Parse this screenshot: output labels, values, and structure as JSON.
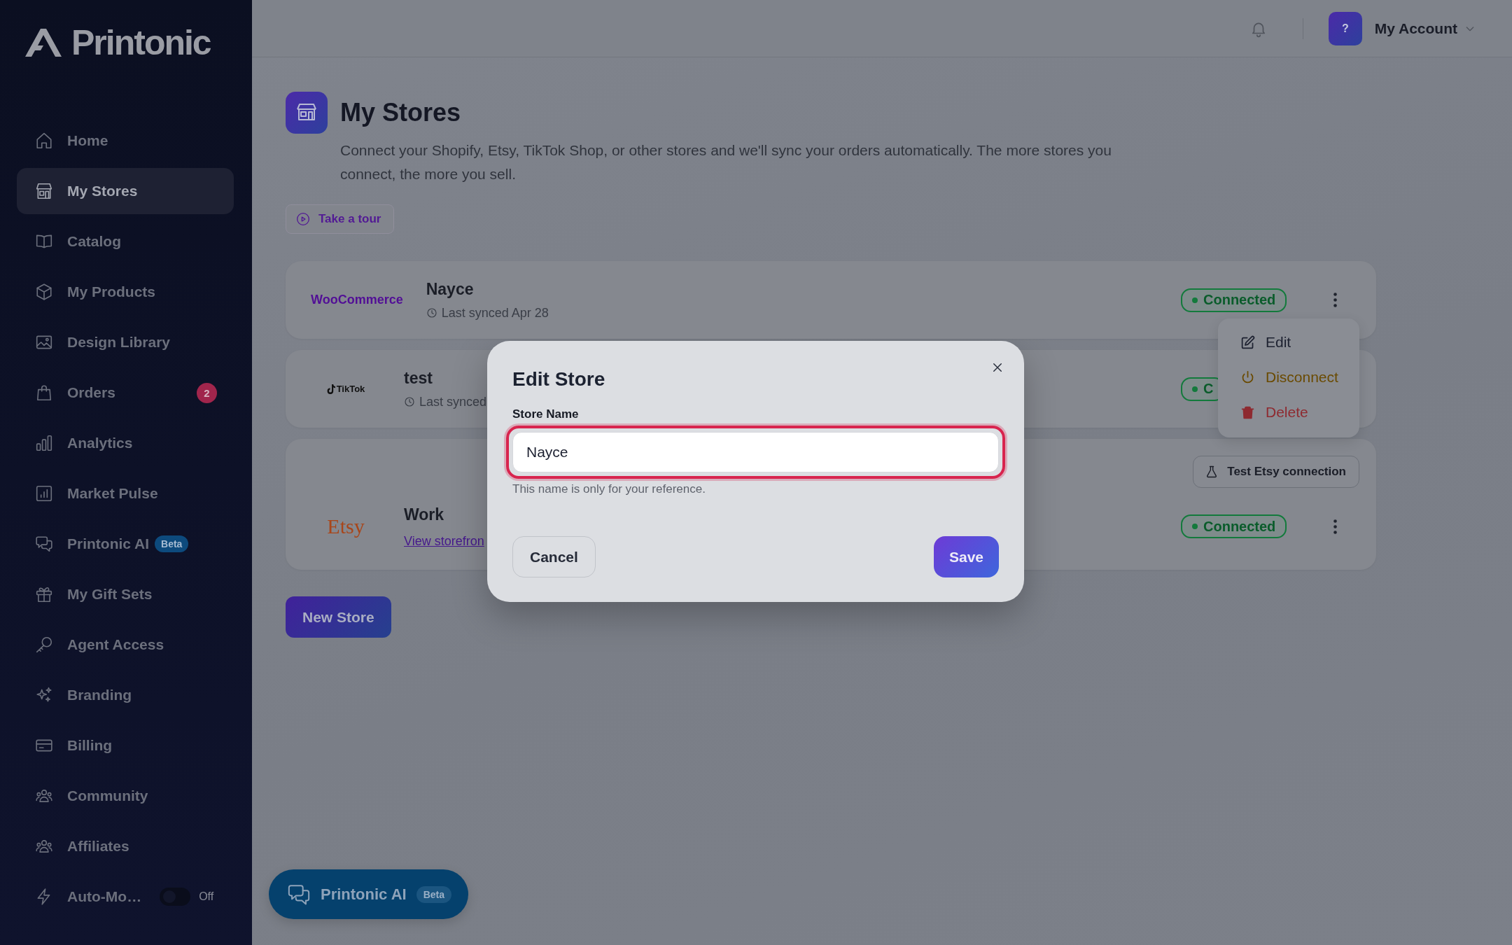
{
  "sidebar": {
    "logo": "Printonic",
    "items": [
      {
        "label": "Home",
        "selected": false
      },
      {
        "label": "My Stores",
        "selected": true
      },
      {
        "label": "Catalog",
        "selected": false
      },
      {
        "label": "My Products",
        "selected": false
      },
      {
        "label": "Design Library",
        "selected": false
      },
      {
        "label": "Orders",
        "selected": false,
        "badge": "2"
      },
      {
        "label": "Analytics",
        "selected": false
      },
      {
        "label": "Market Pulse",
        "selected": false
      },
      {
        "label": "Printonic AI",
        "selected": false,
        "tag": "Beta"
      },
      {
        "label": "My Gift Sets",
        "selected": false
      },
      {
        "label": "Agent Access",
        "selected": false
      },
      {
        "label": "Branding",
        "selected": false
      },
      {
        "label": "Billing",
        "selected": false
      },
      {
        "label": "Community",
        "selected": false
      },
      {
        "label": "Affiliates",
        "selected": false
      },
      {
        "label": "Auto-Mo…",
        "selected": false,
        "toggle": {
          "on": false,
          "label": "Off"
        }
      }
    ]
  },
  "header": {
    "account": {
      "avatar": "?",
      "name": "My Account"
    }
  },
  "page": {
    "title": "My Stores",
    "description": "Connect your Shopify, Etsy, TikTok Shop, or other stores and we'll sync your orders automatically. The more stores you connect, the more you sell.",
    "tour_button": "Take a tour",
    "new_store_button": "New Store"
  },
  "stores": [
    {
      "kind": "woocommerce",
      "platform": "WooCommerce",
      "name": "Nayce",
      "sync": "Last synced Apr 28",
      "status": "Connected",
      "menu_open": true
    },
    {
      "kind": "tiktok",
      "platform": "TikTok",
      "name": "test",
      "sync": "Last synced",
      "status": "C",
      "menu_open": false
    },
    {
      "kind": "etsy",
      "platform": "Etsy",
      "name": "Work",
      "link": "View storefron",
      "status": "Connected",
      "test_button": "Test Etsy connection",
      "menu_open": false
    }
  ],
  "store_menu": {
    "items": [
      {
        "kind": "edit",
        "label": "Edit"
      },
      {
        "kind": "disconnect",
        "label": "Disconnect"
      },
      {
        "kind": "delete",
        "label": "Delete"
      }
    ]
  },
  "ai_button": {
    "label": "Printonic AI",
    "tag": "Beta"
  },
  "modal": {
    "title": "Edit Store",
    "field": {
      "label": "Store Name",
      "value": "Nayce",
      "focused": true,
      "help": "This name is only for your reference."
    },
    "buttons": [
      {
        "kind": "secondary",
        "label": "Cancel"
      },
      {
        "kind": "primary",
        "label": "Save"
      }
    ]
  }
}
